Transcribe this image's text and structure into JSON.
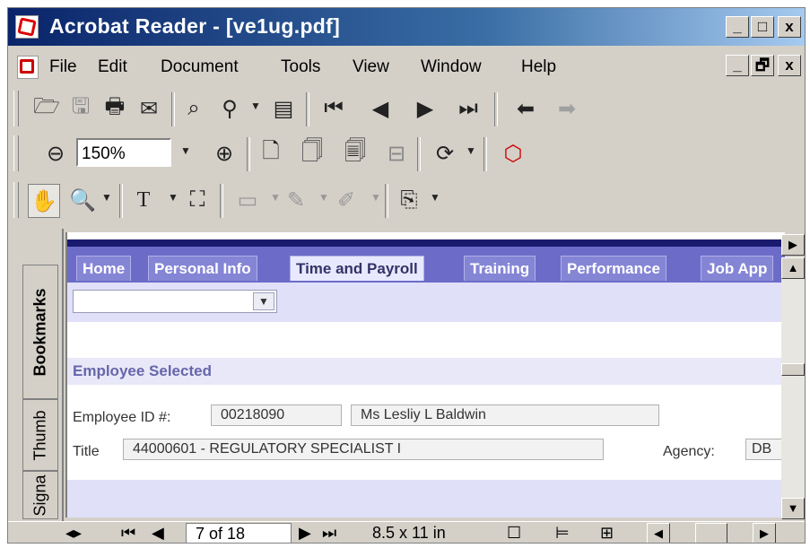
{
  "window": {
    "title": "Acrobat Reader - [ve1ug.pdf]",
    "controls": {
      "minimize": "_",
      "maximize": "□",
      "close": "x",
      "restore": "🗗"
    }
  },
  "menu": {
    "items": [
      "File",
      "Edit",
      "Document",
      "Tools",
      "View",
      "Window",
      "Help"
    ]
  },
  "toolbar": {
    "zoom_value": "150%"
  },
  "side_tabs": {
    "bookmarks": "Bookmarks",
    "thumbnails": "Thumb",
    "signatures": "Signa"
  },
  "document": {
    "tabs": [
      "Home",
      "Personal Info",
      "Time and Payroll",
      "Training",
      "Performance",
      "Job App"
    ],
    "active_tab": "Time and Payroll",
    "section_title": "Employee Selected",
    "employee_id_label": "Employee ID #:",
    "employee_id": "00218090",
    "employee_name": "Ms Lesliy L Baldwin",
    "title_label": "Title",
    "title_value": "44000601 - REGULATORY SPECIALIST I",
    "agency_label": "Agency:",
    "agency_value": "DB"
  },
  "statusbar": {
    "page": "7 of 18",
    "page_size": "8.5 x 11 in"
  }
}
